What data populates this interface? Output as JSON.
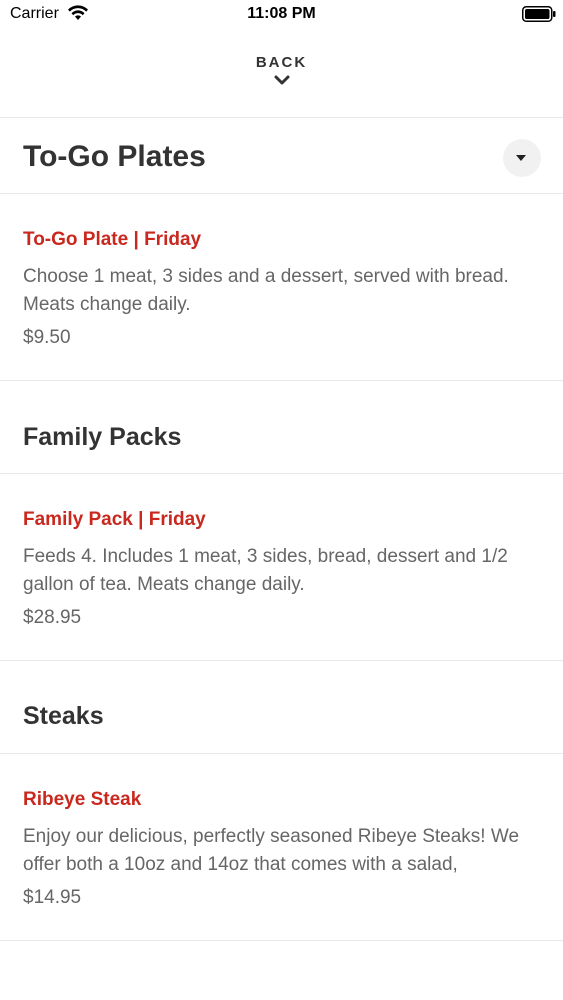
{
  "status_bar": {
    "carrier": "Carrier",
    "time": "11:08 PM",
    "wifi_icon": "wifi-icon",
    "battery_icon": "battery-icon"
  },
  "nav": {
    "back_label": "BACK",
    "back_icon": "chevron-down-icon"
  },
  "sections": [
    {
      "title": "To-Go Plates",
      "collapse_icon": "caret-down-icon",
      "items": [
        {
          "name": "To-Go Plate | Friday",
          "description": "Choose 1 meat, 3 sides and a dessert, served with bread. Meats change daily.",
          "price": "$9.50"
        }
      ]
    },
    {
      "title": "Family Packs",
      "items": [
        {
          "name": "Family Pack | Friday",
          "description": "Feeds 4. Includes 1 meat, 3 sides, bread, dessert and 1/2 gallon of tea. Meats change daily.",
          "price": "$28.95"
        }
      ]
    },
    {
      "title": "Steaks",
      "items": [
        {
          "name": "Ribeye Steak",
          "description": "Enjoy our delicious, perfectly seasoned Ribeye Steaks! We offer both a 10oz and 14oz that comes with a salad,",
          "price": "$14.95"
        }
      ]
    }
  ],
  "colors": {
    "item_name": "#c8281e",
    "heading": "#333333",
    "body_text": "#666666",
    "divider": "#e8e8e8"
  }
}
